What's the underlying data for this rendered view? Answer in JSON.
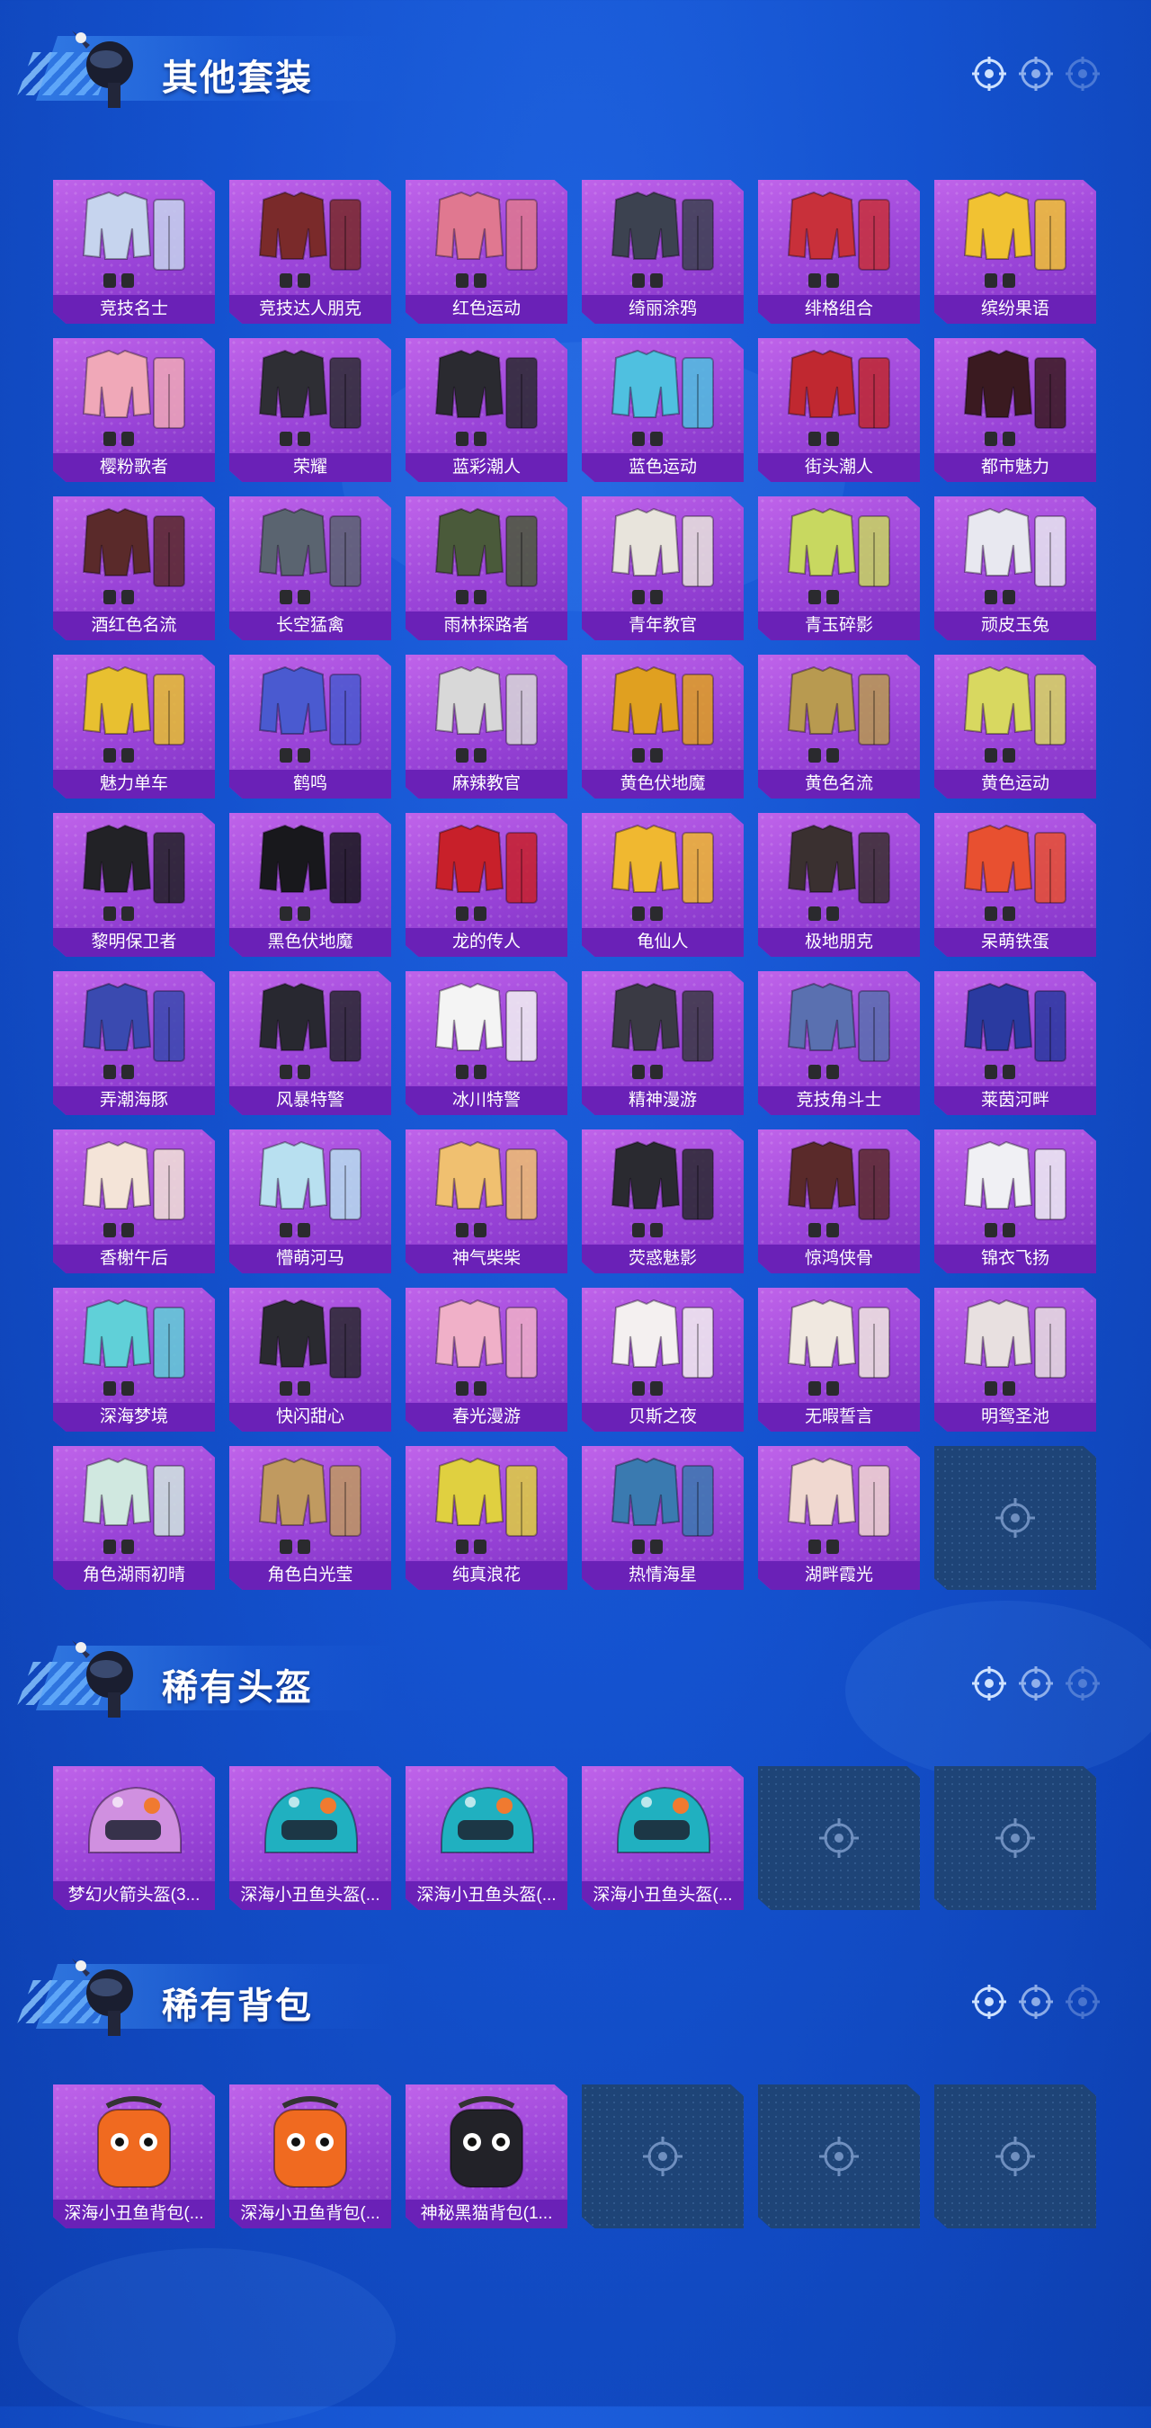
{
  "sections": [
    {
      "title": "其他套装",
      "items": [
        {
          "label": "竞技名士",
          "color": "#c6d4ee"
        },
        {
          "label": "竞技达人朋克",
          "color": "#7a2a2a"
        },
        {
          "label": "红色运动",
          "color": "#e07890"
        },
        {
          "label": "绮丽涂鸦",
          "color": "#3c4250"
        },
        {
          "label": "绯格组合",
          "color": "#c8303a"
        },
        {
          "label": "缤纷果语",
          "color": "#f1c232"
        },
        {
          "label": "樱粉歌者",
          "color": "#f0a8b8"
        },
        {
          "label": "荣耀",
          "color": "#2e2e34"
        },
        {
          "label": "蓝彩潮人",
          "color": "#2a2a30"
        },
        {
          "label": "蓝色运动",
          "color": "#4fc0e0"
        },
        {
          "label": "街头潮人",
          "color": "#c02830"
        },
        {
          "label": "都市魅力",
          "color": "#3a1a20"
        },
        {
          "label": "酒红色名流",
          "color": "#5a2a2a"
        },
        {
          "label": "长空猛禽",
          "color": "#5a6470"
        },
        {
          "label": "雨林探路者",
          "color": "#4a5a3a"
        },
        {
          "label": "青年教官",
          "color": "#e8e4dc"
        },
        {
          "label": "青玉碎影",
          "color": "#c8d860"
        },
        {
          "label": "顽皮玉兔",
          "color": "#e8e8f0"
        },
        {
          "label": "魅力单车",
          "color": "#e8c030"
        },
        {
          "label": "鹤鸣",
          "color": "#4a5ad0"
        },
        {
          "label": "麻辣教官",
          "color": "#d8d8d8"
        },
        {
          "label": "黄色伏地魔",
          "color": "#e0a020"
        },
        {
          "label": "黄色名流",
          "color": "#b89a50"
        },
        {
          "label": "黄色运动",
          "color": "#d8d860"
        },
        {
          "label": "黎明保卫者",
          "color": "#222226"
        },
        {
          "label": "黑色伏地魔",
          "color": "#18181c"
        },
        {
          "label": "龙的传人",
          "color": "#c8202a"
        },
        {
          "label": "龟仙人",
          "color": "#f0b830"
        },
        {
          "label": "极地朋克",
          "color": "#3a3030"
        },
        {
          "label": "呆萌铁蛋",
          "color": "#e85030"
        },
        {
          "label": "弄潮海豚",
          "color": "#3a4ab0"
        },
        {
          "label": "风暴特警",
          "color": "#282830"
        },
        {
          "label": "冰川特警",
          "color": "#f4f4f4"
        },
        {
          "label": "精神漫游",
          "color": "#3a3a44"
        },
        {
          "label": "竞技角斗士",
          "color": "#5a70b0"
        },
        {
          "label": "莱茵河畔",
          "color": "#2a3aa0"
        },
        {
          "label": "香榭午后",
          "color": "#f4e4d8"
        },
        {
          "label": "懵萌河马",
          "color": "#b8e0f0"
        },
        {
          "label": "神气柴柴",
          "color": "#f0c070"
        },
        {
          "label": "荧惑魅影",
          "color": "#2a2a30"
        },
        {
          "label": "惊鸿侠骨",
          "color": "#5a2a2a"
        },
        {
          "label": "锦衣飞扬",
          "color": "#f0f0f4"
        },
        {
          "label": "深海梦境",
          "color": "#60d0d8"
        },
        {
          "label": "快闪甜心",
          "color": "#2a2a30"
        },
        {
          "label": "春光漫游",
          "color": "#f0b0c8"
        },
        {
          "label": "贝斯之夜",
          "color": "#f4f0f0"
        },
        {
          "label": "无暇誓言",
          "color": "#f0e8e0"
        },
        {
          "label": "明鸳圣池",
          "color": "#e8e0e0"
        },
        {
          "label": "角色湖雨初晴",
          "color": "#d0e8e0"
        },
        {
          "label": "角色白光莹",
          "color": "#c09a60"
        },
        {
          "label": "纯真浪花",
          "color": "#e0d040"
        },
        {
          "label": "热情海星",
          "color": "#3a7ab0"
        },
        {
          "label": "湖畔霞光",
          "color": "#f0d8d0"
        },
        {
          "label": "",
          "color": ""
        }
      ]
    },
    {
      "title": "稀有头盔",
      "items": [
        {
          "label": "梦幻火箭头盔(3...",
          "color": "#d090e0"
        },
        {
          "label": "深海小丑鱼头盔(...",
          "color": "#20b0c0"
        },
        {
          "label": "深海小丑鱼头盔(...",
          "color": "#20b0c0"
        },
        {
          "label": "深海小丑鱼头盔(...",
          "color": "#20b0c0"
        },
        {
          "label": "",
          "color": ""
        },
        {
          "label": "",
          "color": ""
        }
      ]
    },
    {
      "title": "稀有背包",
      "items": [
        {
          "label": "深海小丑鱼背包(...",
          "color": "#f06a20"
        },
        {
          "label": "深海小丑鱼背包(...",
          "color": "#f06a20"
        },
        {
          "label": "神秘黑猫背包(1...",
          "color": "#222228"
        },
        {
          "label": "",
          "color": ""
        },
        {
          "label": "",
          "color": ""
        },
        {
          "label": "",
          "color": ""
        }
      ]
    }
  ]
}
